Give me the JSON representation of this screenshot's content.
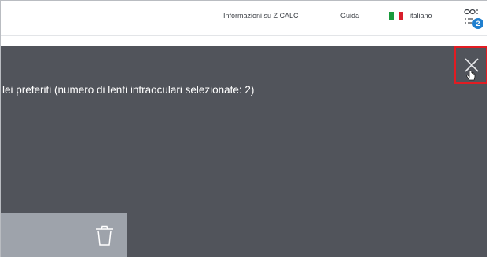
{
  "header": {
    "about_link": "Informazioni su Z CALC",
    "help_link": "Guida",
    "language": {
      "label": "italiano",
      "flag_colors": [
        "#1a9a3c",
        "#ffffff",
        "#d81e2b"
      ]
    },
    "selection_list": {
      "icon": "list-icon",
      "badge_count": "2"
    }
  },
  "overlay": {
    "title": "lei preferiti (numero di lenti intraoculari selezionate: 2)",
    "close_icon": "close-icon",
    "card": {
      "delete_icon": "trash-icon"
    }
  },
  "colors": {
    "overlay_bg": "#51545b",
    "card_bg": "#9ea3ab",
    "highlight": "#e21c22",
    "badge": "#1f7fcf"
  }
}
